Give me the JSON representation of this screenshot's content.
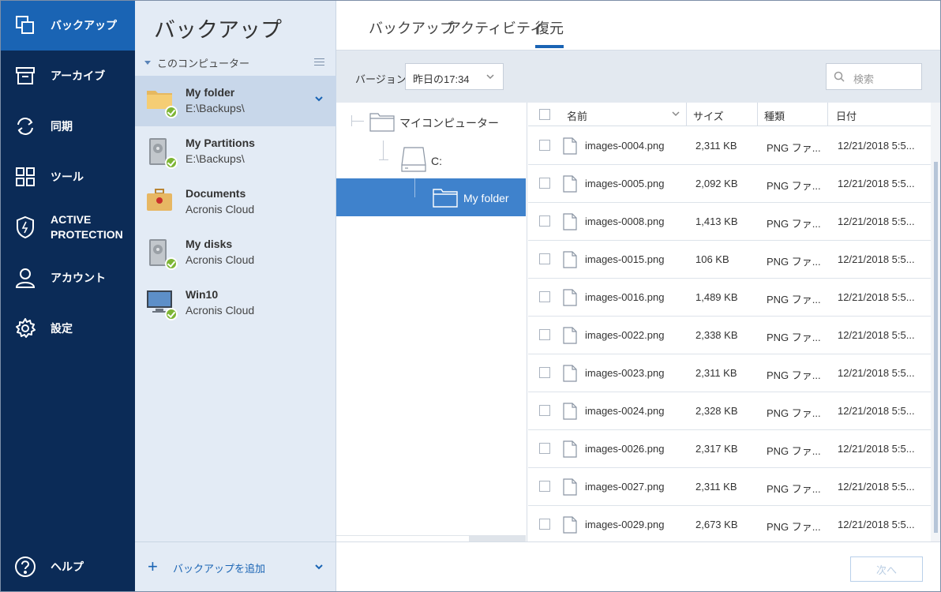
{
  "nav": {
    "items": [
      {
        "label": "バックアップ",
        "icon": "copy-icon",
        "active": true
      },
      {
        "label": "アーカイブ",
        "icon": "archive-icon"
      },
      {
        "label": "同期",
        "icon": "sync-icon"
      },
      {
        "label": "ツール",
        "icon": "tools-grid-icon"
      },
      {
        "label_line1": "ACTIVE",
        "label_line2": "PROTECTION",
        "icon": "shield-icon"
      },
      {
        "label": "アカウント",
        "icon": "user-icon"
      },
      {
        "label": "設定",
        "icon": "gear-icon"
      }
    ],
    "help_label": "ヘルプ"
  },
  "backup_list": {
    "title": "バックアップ",
    "section_label": "このコンピューター",
    "items": [
      {
        "name": "My folder",
        "location": "E:\\Backups\\",
        "icon": "folder-icon"
      },
      {
        "name": "My Partitions",
        "location": "E:\\Backups\\",
        "icon": "hard-disk-icon"
      },
      {
        "name": "Documents",
        "location": "Acronis Cloud",
        "icon": "briefcase-icon"
      },
      {
        "name": "My disks",
        "location": "Acronis Cloud",
        "icon": "hard-disk-icon"
      },
      {
        "name": "Win10",
        "location": "Acronis Cloud",
        "icon": "monitor-icon"
      }
    ],
    "add_label": "バックアップを追加"
  },
  "tabs": [
    "バックアップ",
    "アクティビティ",
    "復元"
  ],
  "toolbar": {
    "version_label": "バージョン:",
    "version_value": "昨日の17:34",
    "search_placeholder": "検索"
  },
  "tree": {
    "root": "マイコンピューター",
    "drive": "C:",
    "folder": "My folder"
  },
  "files": {
    "columns": [
      "名前",
      "サイズ",
      "種類",
      "日付"
    ],
    "rows": [
      {
        "name": "images-0004.png",
        "size": "2,311 KB",
        "type": "PNG ファ...",
        "date": "12/21/2018 5:5..."
      },
      {
        "name": "images-0005.png",
        "size": "2,092 KB",
        "type": "PNG ファ...",
        "date": "12/21/2018 5:5..."
      },
      {
        "name": "images-0008.png",
        "size": "1,413 KB",
        "type": "PNG ファ...",
        "date": "12/21/2018 5:5..."
      },
      {
        "name": "images-0015.png",
        "size": "106 KB",
        "type": "PNG ファ...",
        "date": "12/21/2018 5:5..."
      },
      {
        "name": "images-0016.png",
        "size": "1,489 KB",
        "type": "PNG ファ...",
        "date": "12/21/2018 5:5..."
      },
      {
        "name": "images-0022.png",
        "size": "2,338 KB",
        "type": "PNG ファ...",
        "date": "12/21/2018 5:5..."
      },
      {
        "name": "images-0023.png",
        "size": "2,311 KB",
        "type": "PNG ファ...",
        "date": "12/21/2018 5:5..."
      },
      {
        "name": "images-0024.png",
        "size": "2,328 KB",
        "type": "PNG ファ...",
        "date": "12/21/2018 5:5..."
      },
      {
        "name": "images-0026.png",
        "size": "2,317 KB",
        "type": "PNG ファ...",
        "date": "12/21/2018 5:5..."
      },
      {
        "name": "images-0027.png",
        "size": "2,311 KB",
        "type": "PNG ファ...",
        "date": "12/21/2018 5:5..."
      },
      {
        "name": "images-0029.png",
        "size": "2,673 KB",
        "type": "PNG ファ...",
        "date": "12/21/2018 5:5..."
      }
    ]
  },
  "footer": {
    "next_label": "次へ"
  },
  "colors": {
    "nav_bg": "#0b2b57",
    "nav_active": "#1a64b4",
    "accent": "#1a64b4",
    "selection": "#3f82cc",
    "check": "#7db534"
  }
}
